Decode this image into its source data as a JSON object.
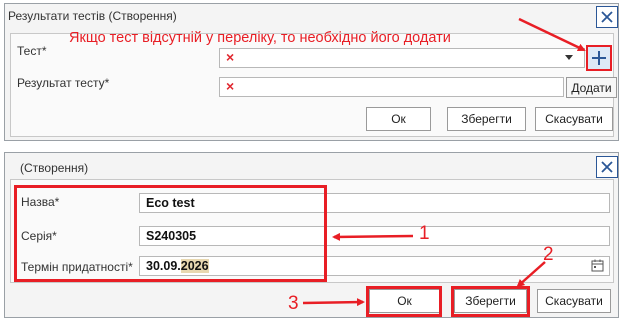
{
  "dialog1": {
    "title": "Результати тестів (Створення)",
    "test_label": "Тест*",
    "result_label": "Результат тесту*",
    "test_value_marker": "×",
    "result_value_marker": "×",
    "ok_label": "Ок",
    "save_label": "Зберегти",
    "cancel_label": "Скасувати",
    "add_tooltip": "Додати",
    "add_button_symbol": "+"
  },
  "annotation_text": "Якщо тест відсутній у переліку, то необхідно його додати",
  "dialog2": {
    "title": "(Створення)",
    "name_label": "Назва*",
    "name_value": "Eco test",
    "series_label": "Серія*",
    "series_value": "S240305",
    "expiry_label": "Термін придатності*",
    "expiry_value_plain": "30.09.",
    "expiry_value_highlight": "2026",
    "ok_label": "Ок",
    "save_label": "Зберегти",
    "cancel_label": "Скасувати"
  },
  "callouts": {
    "one": "1",
    "two": "2",
    "three": "3"
  },
  "colors": {
    "annotation": "#e81e25",
    "accent": "#2b5797",
    "highlight": "#e8d8b0"
  },
  "icons": [
    "close-icon",
    "dropdown-arrow-icon",
    "plus-icon",
    "calendar-icon"
  ]
}
